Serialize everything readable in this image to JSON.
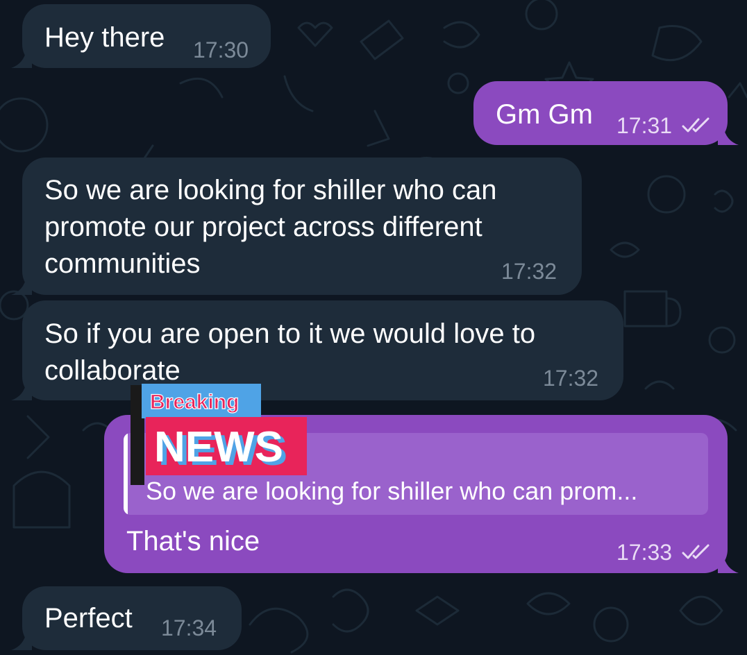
{
  "messages": [
    {
      "id": "m1",
      "direction": "incoming",
      "text": "Hey there",
      "time": "17:30"
    },
    {
      "id": "m2",
      "direction": "outgoing",
      "text": "Gm Gm",
      "time": "17:31",
      "status": "read-double-check"
    },
    {
      "id": "m3",
      "direction": "incoming",
      "lines": [
        "So we are looking for shiller who can",
        "promote our project across different",
        "communities"
      ],
      "time": "17:32"
    },
    {
      "id": "m4",
      "direction": "incoming",
      "lines": [
        "So if you are open to it we would love to",
        "collaborate"
      ],
      "time": "17:32"
    },
    {
      "id": "m5",
      "direction": "outgoing",
      "reply_to": "So we are looking for shiller who can prom...",
      "text": "That's nice",
      "time": "17:33",
      "status": "read-double-check"
    },
    {
      "id": "m6",
      "direction": "incoming",
      "text": "Perfect",
      "time": "17:34"
    }
  ],
  "sticker": {
    "top_word": "Breaking",
    "bottom_word": "NEWS"
  },
  "colors": {
    "background": "#0e1621",
    "incoming_bubble": "#1e2c3a",
    "outgoing_bubble": "#8b4abf",
    "reply_block": "#9a62cc",
    "sticker_blue": "#4fa3e6",
    "sticker_pink": "#e8245a"
  },
  "icons": {
    "read_status": "double-check-icon"
  }
}
